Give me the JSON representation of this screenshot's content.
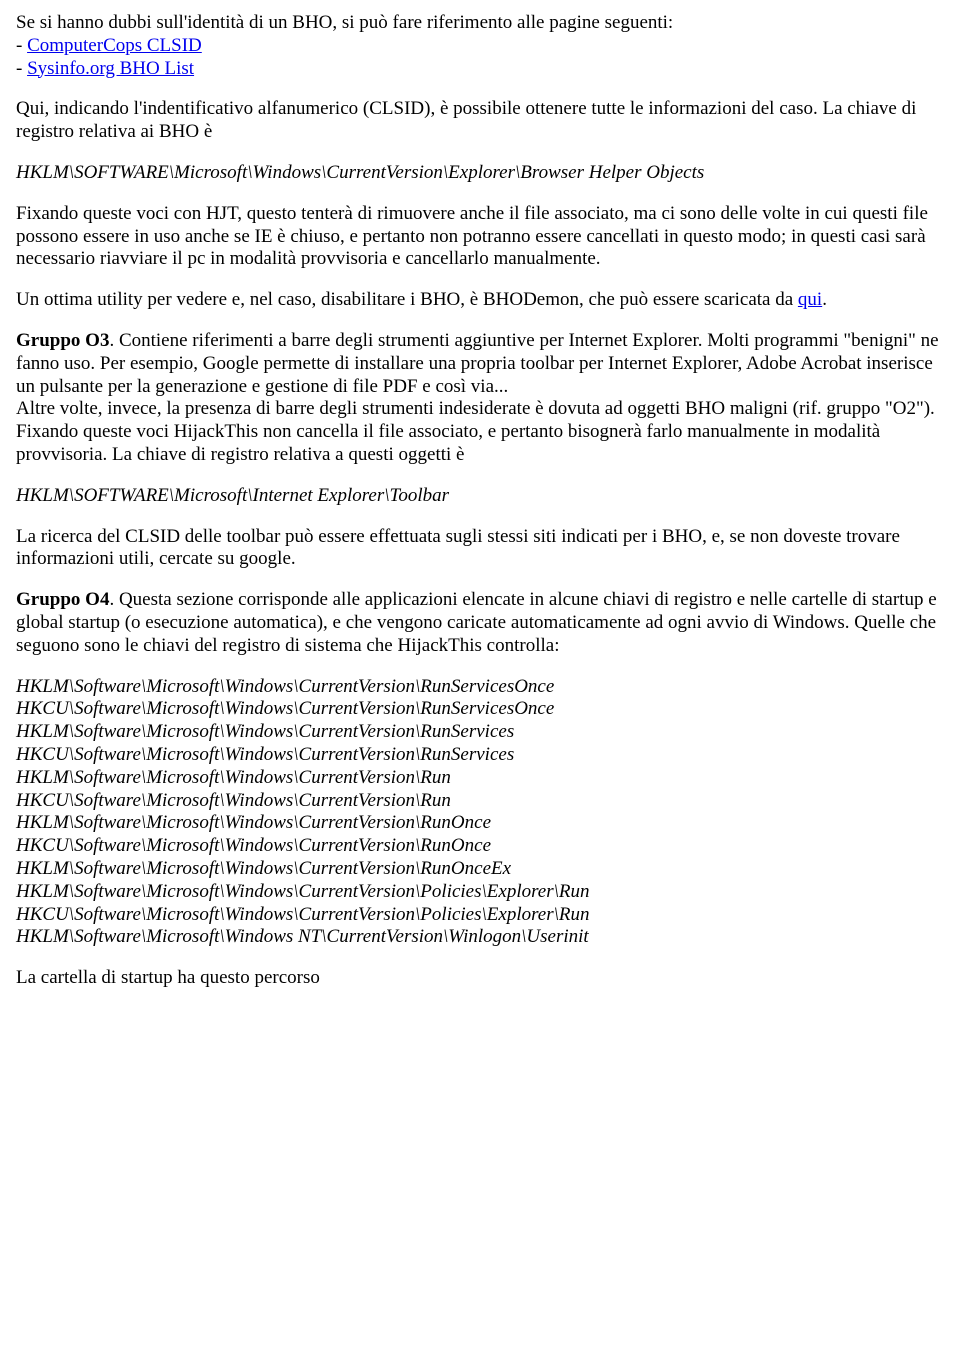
{
  "p1": {
    "line1": "Se si hanno dubbi sull'identità di un BHO, si può fare riferimento alle pagine seguenti:",
    "dash1": "- ",
    "link1": "ComputerCops CLSID",
    "dash2": "- ",
    "link2": "Sysinfo.org BHO List"
  },
  "p2": "Qui, indicando l'indentificativo alfanumerico (CLSID), è possibile ottenere tutte le informazioni del caso. La chiave di registro relativa ai BHO è",
  "reg1": "HKLM\\SOFTWARE\\Microsoft\\Windows\\CurrentVersion\\Explorer\\Browser Helper Objects",
  "p3": "Fixando queste voci con HJT, questo tenterà di rimuovere anche il file associato, ma ci sono delle volte in cui questi file possono essere in uso anche se IE è chiuso, e pertanto non potranno essere cancellati in questo modo; in questi casi sarà necessario riavviare il pc in modalità provvisoria e cancellarlo manualmente.",
  "p4a": "Un ottima utility per vedere e, nel caso, disabilitare i BHO, è BHODemon, che può essere scaricata da ",
  "p4link": "qui",
  "p4b": ".",
  "o3": {
    "label": "Gruppo O3",
    "text1": ". Contiene riferimenti a barre degli strumenti aggiuntive per Internet Explorer. Molti programmi \"benigni\" ne fanno uso. Per esempio, Google permette di installare una propria toolbar per Internet Explorer, Adobe Acrobat inserisce un pulsante per la generazione e gestione di file PDF e così via...",
    "text2": "Altre volte, invece, la presenza di barre degli strumenti indesiderate è dovuta ad oggetti BHO maligni (rif. gruppo \"O2\"). Fixando queste voci HijackThis non cancella il file associato, e pertanto bisognerà farlo manualmente in modalità provvisoria. La chiave di registro relativa a questi oggetti è"
  },
  "reg2": "HKLM\\SOFTWARE\\Microsoft\\Internet Explorer\\Toolbar",
  "p5": "La ricerca del CLSID delle toolbar può essere effettuata sugli stessi siti indicati per i BHO, e, se non doveste trovare informazioni utili, cercate su google.",
  "o4": {
    "label": "Gruppo O4",
    "text": ". Questa sezione corrisponde alle applicazioni elencate in alcune chiavi di registro e nelle cartelle di startup e global startup (o esecuzione automatica), e che vengono caricate automaticamente ad ogni avvio di Windows. Quelle che seguono sono le chiavi del registro di sistema che HijackThis controlla:"
  },
  "reglist": [
    "HKLM\\Software\\Microsoft\\Windows\\CurrentVersion\\RunServicesOnce",
    "HKCU\\Software\\Microsoft\\Windows\\CurrentVersion\\RunServicesOnce",
    "HKLM\\Software\\Microsoft\\Windows\\CurrentVersion\\RunServices",
    "HKCU\\Software\\Microsoft\\Windows\\CurrentVersion\\RunServices",
    "HKLM\\Software\\Microsoft\\Windows\\CurrentVersion\\Run",
    "HKCU\\Software\\Microsoft\\Windows\\CurrentVersion\\Run",
    "HKLM\\Software\\Microsoft\\Windows\\CurrentVersion\\RunOnce",
    "HKCU\\Software\\Microsoft\\Windows\\CurrentVersion\\RunOnce",
    "HKLM\\Software\\Microsoft\\Windows\\CurrentVersion\\RunOnceEx",
    "HKLM\\Software\\Microsoft\\Windows\\CurrentVersion\\Policies\\Explorer\\Run",
    "HKCU\\Software\\Microsoft\\Windows\\CurrentVersion\\Policies\\Explorer\\Run",
    "HKLM\\Software\\Microsoft\\Windows NT\\CurrentVersion\\Winlogon\\Userinit"
  ],
  "p6": "La cartella di startup ha questo percorso"
}
